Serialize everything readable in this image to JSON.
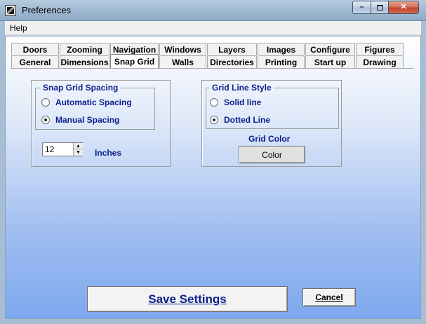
{
  "window": {
    "title": "Preferences",
    "minimize_glyph": "–",
    "close_glyph": "✕"
  },
  "menu": {
    "help": "Help"
  },
  "tabs": {
    "row1": [
      "Doors",
      "Zooming",
      "Navigation",
      "Windows",
      "Layers",
      "Images",
      "Configure",
      "Figures"
    ],
    "row2": [
      "General",
      "Dimensions",
      "Snap Grid",
      "Walls",
      "Directories",
      "Printing",
      "Start up",
      "Drawing"
    ],
    "active": "Snap Grid"
  },
  "snap_grid_spacing": {
    "title": "Snap Grid Spacing",
    "automatic_label": "Automatic Spacing",
    "manual_label": "Manual Spacing",
    "selected": "manual",
    "value": "12",
    "unit": "Inches",
    "spin_up": "▲",
    "spin_down": "▼"
  },
  "grid_line_style": {
    "title": "Grid Line Style",
    "solid_label": "Solid line",
    "dotted_label": "Dotted Line",
    "selected": "dotted",
    "grid_color_label": "Grid Color",
    "color_button": "Color"
  },
  "actions": {
    "save_label": "Save Settings",
    "cancel_label": "Cancel"
  },
  "colors": {
    "label_blue": "#0a1f8a",
    "gradient_top": "#ffffff",
    "gradient_bottom": "#7ea8ef"
  }
}
